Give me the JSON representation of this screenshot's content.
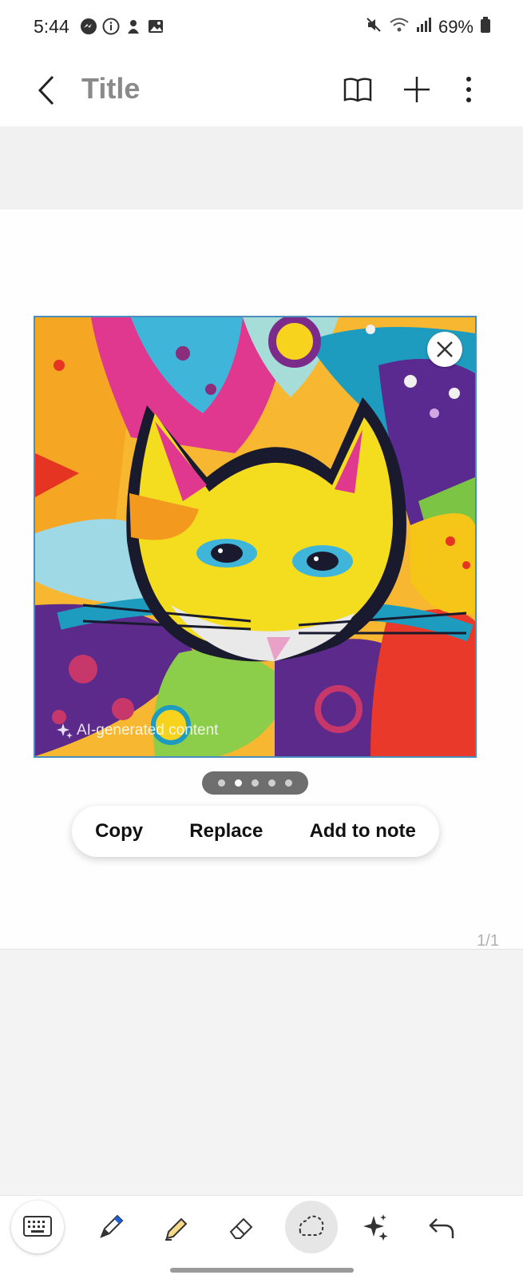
{
  "status_bar": {
    "time": "5:44",
    "battery": "69%"
  },
  "app_bar": {
    "title": "Title"
  },
  "image": {
    "ai_label": "AI-generated content"
  },
  "pager": {
    "total_dots": 5,
    "active_index": 1
  },
  "context_menu": {
    "copy": "Copy",
    "replace": "Replace",
    "add_to_note": "Add to note"
  },
  "page_indicator": "1/1",
  "colors": {
    "accent_border": "#4b8dbb",
    "title_gray": "#8a8a8a"
  }
}
